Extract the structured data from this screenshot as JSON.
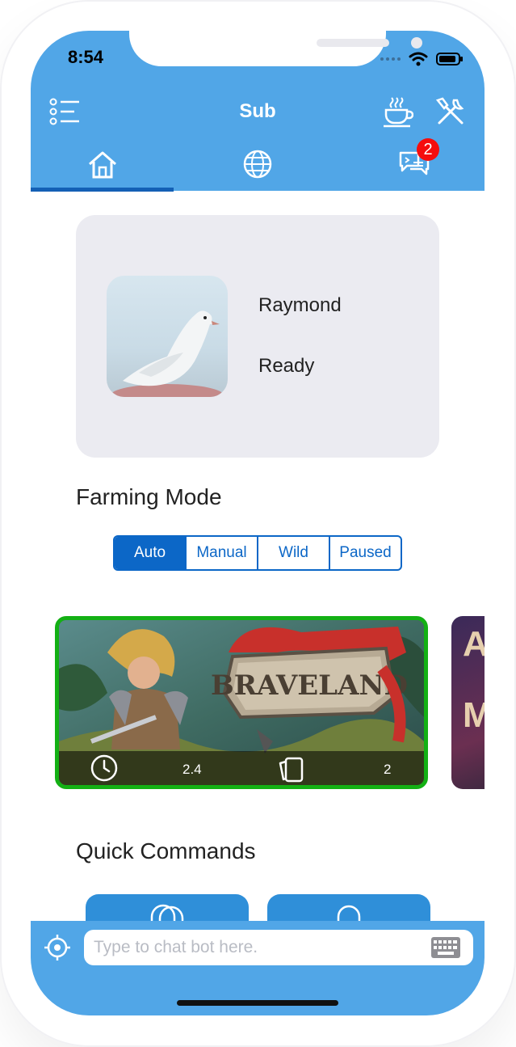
{
  "status_bar": {
    "time": "8:54"
  },
  "header": {
    "title": "Sub",
    "unread_badge": "2"
  },
  "tabs": [
    {
      "name": "home",
      "icon": "home-icon",
      "active": true
    },
    {
      "name": "globe",
      "icon": "globe-icon",
      "active": false
    },
    {
      "name": "chat",
      "icon": "chat-icon",
      "active": false
    }
  ],
  "profile": {
    "name": "Raymond",
    "status": "Ready",
    "avatar_icon": "dove-icon"
  },
  "farming": {
    "label": "Farming Mode",
    "options": [
      "Auto",
      "Manual",
      "Wild",
      "Paused"
    ],
    "selected": "Auto"
  },
  "games": [
    {
      "logo_text": "BRAVELAND",
      "time_value": "2.4",
      "cards_value": "2",
      "selected": true
    },
    {
      "logo_text": "A\nM",
      "selected": false
    }
  ],
  "quick_commands": {
    "label": "Quick Commands"
  },
  "chat": {
    "placeholder": "Type to chat bot here."
  },
  "colors": {
    "primary": "#51a6e7",
    "accent": "#0c67c7",
    "tab_indicator": "#1460b5",
    "selected_border": "#13b014",
    "badge": "#f50d0d",
    "card_bg": "#ebebf1"
  }
}
